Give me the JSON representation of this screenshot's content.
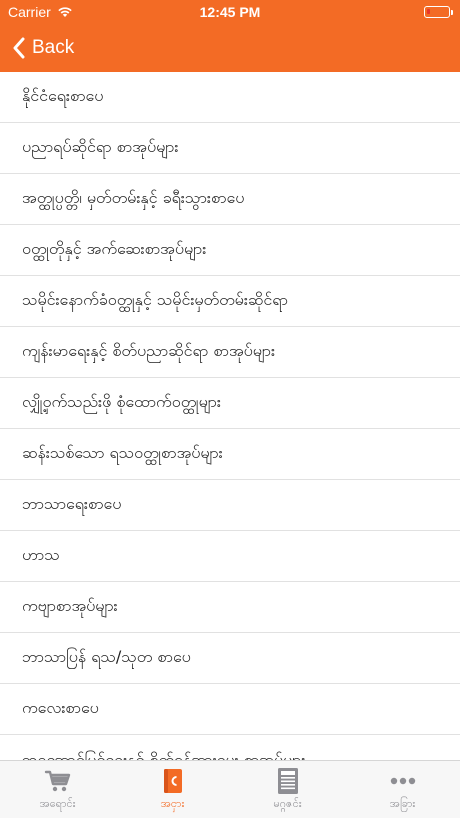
{
  "status_bar": {
    "carrier": "Carrier",
    "time": "12:45 PM",
    "battery_level": 0.15,
    "battery_color": "#e8352a"
  },
  "nav": {
    "back_label": "Back"
  },
  "list": {
    "items": [
      "နိုင်ငံရေးစာပေ",
      "ပညာရပ်ဆိုင်ရာ စာအုပ်များ",
      "အတ္ထုပ္ပတ္တိ၊ မှတ်တမ်းနှင့် ခရီးသွားစာပေ",
      "ဝတ္ထုတိုနှင့် အက်ဆေးစာအုပ်များ",
      "သမိုင်းနောက်ခံဝတ္ထုနှင့် သမိုင်းမှတ်တမ်းဆိုင်ရာ",
      "ကျန်းမာရေးနှင့် စိတ်ပညာဆိုင်ရာ စာအုပ်များ",
      "လျှို့ဝှက်သည်းဖို စုံထောက်ဝတ္ထုများ",
      "ဆန်းသစ်သော ရသဝတ္ထုစာအုပ်များ",
      "ဘာသာရေးစာပေ",
      "ဟာသ",
      "ကဗျာစာအုပ်များ",
      "ဘာသာပြန် ရသ/သုတ စာပေ",
      "ကလေးစာပေ",
      "ဘဝအောင်မြင်ရေးနှင့် စိတ်ခွန်အားပေး စာအုပ်များ"
    ]
  },
  "tabbar": {
    "tabs": [
      {
        "label": "အရောင်း",
        "icon": "cart-icon"
      },
      {
        "label": "အငှား",
        "icon": "book-icon"
      },
      {
        "label": "မဂ္ဂဇင်း",
        "icon": "magazine-icon"
      },
      {
        "label": "အခြား",
        "icon": "more-icon"
      }
    ],
    "active_index": 1
  },
  "colors": {
    "accent": "#f36b25",
    "inactive": "#8e8e93",
    "separator": "#e1e1e1"
  }
}
